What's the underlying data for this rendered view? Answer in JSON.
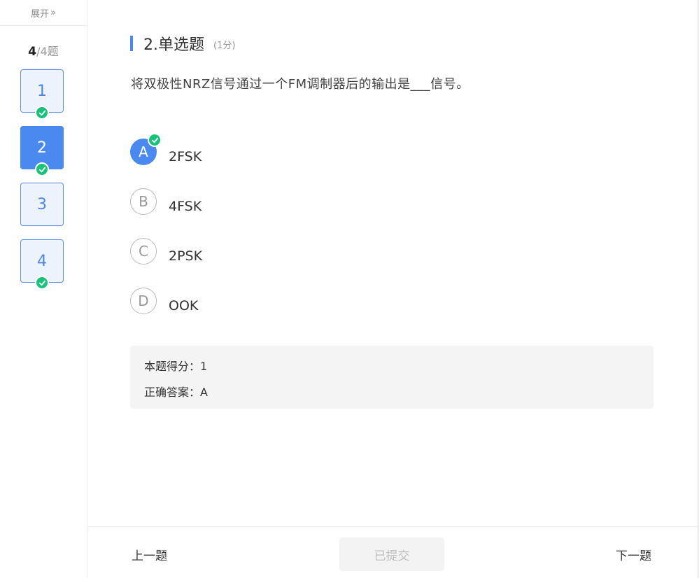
{
  "sidebar": {
    "expand_label": "展开",
    "expand_icon": "»",
    "counter_current": "4",
    "counter_rest": "/4题",
    "questions": [
      {
        "num": "1",
        "state": "done"
      },
      {
        "num": "2",
        "state": "active"
      },
      {
        "num": "3",
        "state": "none"
      },
      {
        "num": "4",
        "state": "done"
      }
    ]
  },
  "question": {
    "title": "2.单选题",
    "score": "(1分)",
    "stem": "将双极性NRZ信号通过一个FM调制器后的输出是___信号。",
    "options": [
      {
        "letter": "A",
        "text": "2FSK"
      },
      {
        "letter": "B",
        "text": "4FSK"
      },
      {
        "letter": "C",
        "text": "2PSK"
      },
      {
        "letter": "D",
        "text": "OOK"
      }
    ],
    "selected": "A"
  },
  "result": {
    "score_label": "本题得分：1",
    "answer_label": "正确答案：A"
  },
  "footer": {
    "prev_label": "上一题",
    "submitted_label": "已提交",
    "next_label": "下一题"
  },
  "colors": {
    "accent": "#4a8af0",
    "success": "#17c27a"
  }
}
